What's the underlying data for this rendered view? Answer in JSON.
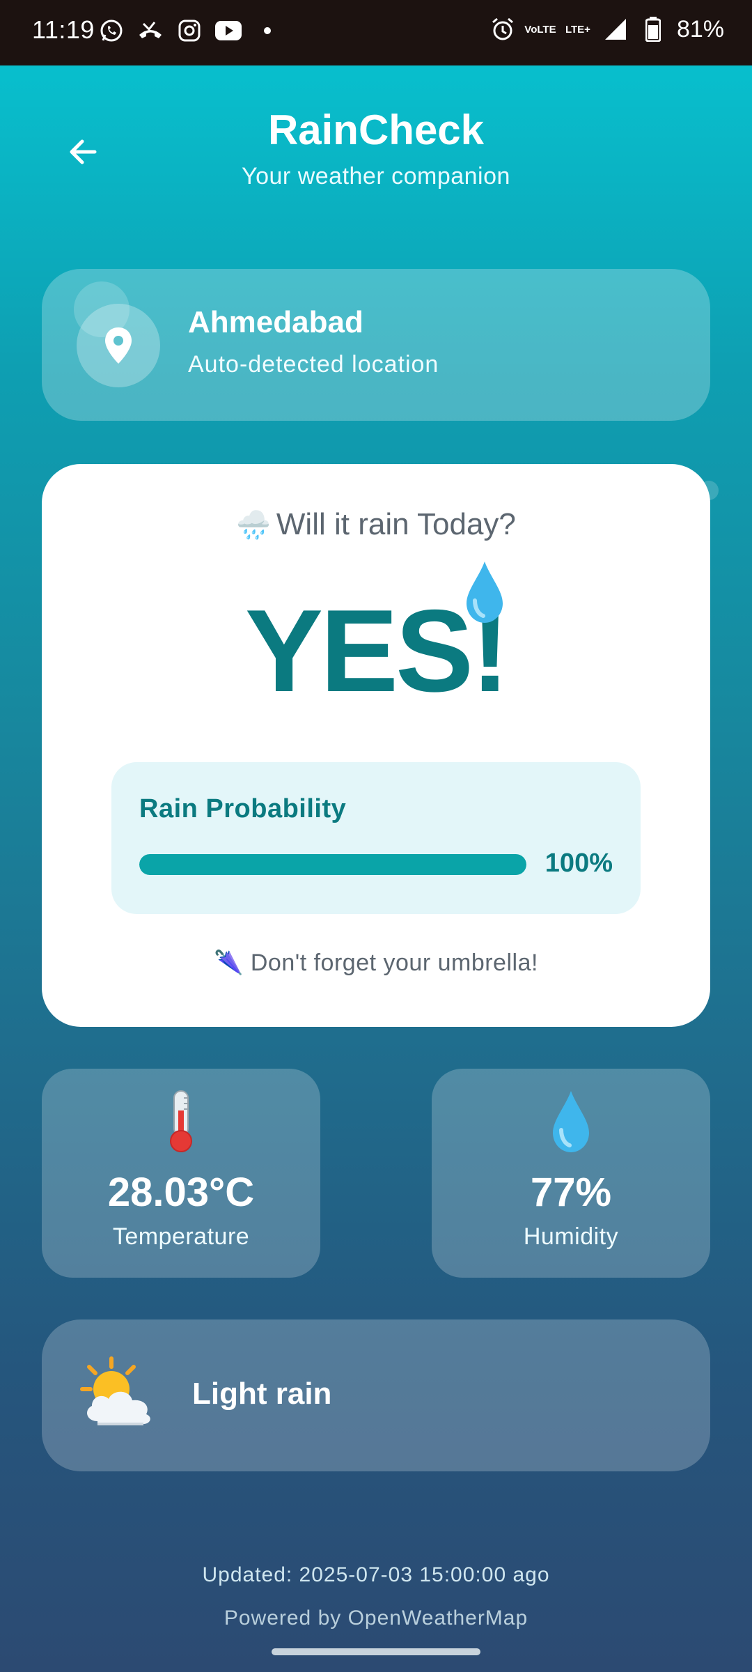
{
  "status_bar": {
    "time": "11:19",
    "battery": "81%",
    "network_vo": "Vo",
    "network_lte": "LTE",
    "network_lte_plus": "LTE+",
    "icons": [
      "whatsapp-icon",
      "missed-call-icon",
      "instagram-icon",
      "youtube-icon",
      "dot-icon",
      "alarm-icon",
      "volte-icon",
      "lte-icon",
      "signal-icon",
      "battery-icon"
    ]
  },
  "header": {
    "title": "RainCheck",
    "subtitle": "Your weather companion",
    "back_icon": "back-arrow-icon"
  },
  "location": {
    "city": "Ahmedabad",
    "subtitle": "Auto-detected location",
    "icon": "location-pin-icon"
  },
  "rain_card": {
    "question_emoji": "🌧️",
    "question": "Will it rain Today?",
    "answer": "YES!",
    "probability_label": "Rain Probability",
    "probability_value": "100%",
    "probability_fraction": 1.0,
    "tip_emoji": "🌂",
    "tip": "Don't forget your umbrella!"
  },
  "stats": {
    "temperature": {
      "value": "28.03°C",
      "label": "Temperature",
      "icon": "thermometer-icon"
    },
    "humidity": {
      "value": "77%",
      "label": "Humidity",
      "icon": "water-drop-icon"
    }
  },
  "condition": {
    "text": "Light rain",
    "icon": "sun-behind-cloud-icon"
  },
  "footer": {
    "updated": "Updated: 2025-07-03 15:00:00 ago",
    "powered": "Powered by OpenWeatherMap"
  },
  "colors": {
    "accent": "#0b7a80",
    "progress_fill": "#0aa4a8",
    "gradient_top": "#07c6d3",
    "gradient_bottom": "#2c4a72"
  }
}
